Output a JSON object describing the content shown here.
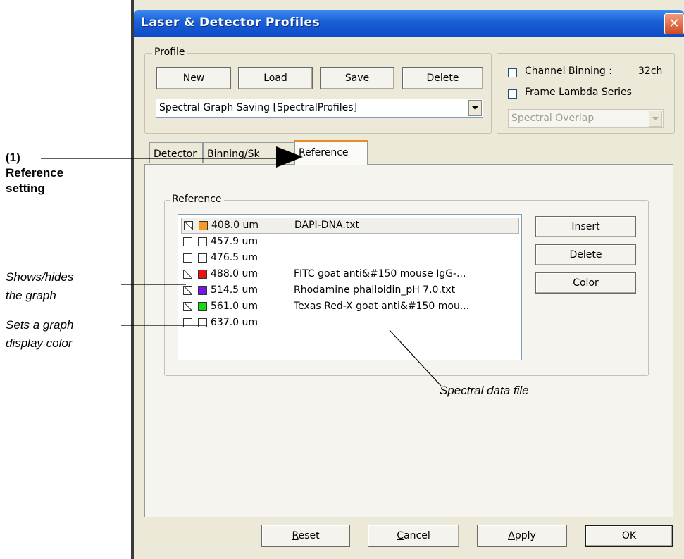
{
  "window": {
    "title": "Laser & Detector Profiles",
    "close_glyph": "✕"
  },
  "profile": {
    "group_label": "Profile",
    "buttons": {
      "new": "New",
      "load": "Load",
      "save": "Save",
      "delete": "Delete"
    },
    "selected_profile": "Spectral Graph Saving [SpectralProfiles]"
  },
  "options": {
    "channel_binning_label": "Channel Binning :",
    "channel_binning_value": "32ch",
    "channel_binning_checked": false,
    "frame_lambda_label": "Frame Lambda Series",
    "frame_lambda_checked": false,
    "spectral_overlap": "Spectral Overlap"
  },
  "tabs": [
    {
      "label": "Detector",
      "active": false
    },
    {
      "label": "Binning/Sk",
      "active": false
    },
    {
      "label": "Reference",
      "active": true
    }
  ],
  "reference": {
    "group_label": "Reference",
    "rows": [
      {
        "shown": true,
        "color": "#f59a23",
        "wavelength": "408.0 um",
        "file": "DAPI-DNA.txt"
      },
      {
        "shown": false,
        "color": "#ffffff",
        "wavelength": "457.9 um",
        "file": ""
      },
      {
        "shown": false,
        "color": "#ffffff",
        "wavelength": "476.5 um",
        "file": ""
      },
      {
        "shown": true,
        "color": "#ee1111",
        "wavelength": "488.0 um",
        "file": "FITC goat anti&#150 mouse IgG-..."
      },
      {
        "shown": true,
        "color": "#7711ee",
        "wavelength": "514.5 um",
        "file": "Rhodamine phalloidin_pH 7.0.txt"
      },
      {
        "shown": true,
        "color": "#11dd11",
        "wavelength": "561.0 um",
        "file": "Texas Red-X goat anti&#150 mou..."
      },
      {
        "shown": false,
        "color": "#ffffff",
        "wavelength": "637.0 um",
        "file": ""
      }
    ],
    "buttons": {
      "insert": "Insert",
      "delete": "Delete",
      "color": "Color"
    }
  },
  "footer": {
    "reset_mnemonic": "R",
    "reset_rest": "eset",
    "cancel_mnemonic": "C",
    "cancel_rest": "ancel",
    "apply_mnemonic": "A",
    "apply_rest": "pply",
    "ok": "OK"
  },
  "annotations": {
    "ref_number": "(1)",
    "ref_line1": "Reference",
    "ref_line2": "setting",
    "show_line1": "Shows/hides",
    "show_line2": "the graph",
    "color_line1": "Sets a graph",
    "color_line2": "display color",
    "file_label": "Spectral data file"
  }
}
